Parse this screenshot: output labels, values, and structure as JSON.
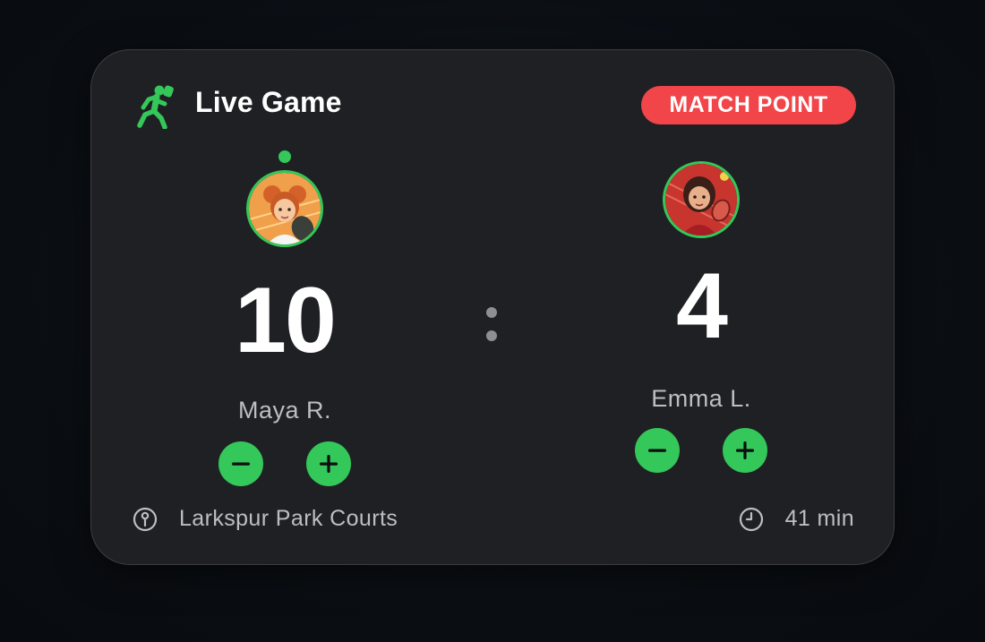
{
  "widget": {
    "title": "Live Game",
    "title_icon": "pickleball-player-icon",
    "status_badge": "MATCH POINT",
    "separator": ":",
    "location": "Larkspur Park Courts",
    "location_icon": "location-pin-icon",
    "duration": "41 min",
    "duration_icon": "clock-icon"
  },
  "players": [
    {
      "name": "Maya R.",
      "score": "10",
      "serving": true,
      "avatar": "avatar-maya"
    },
    {
      "name": "Emma L.",
      "score": "4",
      "serving": false,
      "avatar": "avatar-emma"
    }
  ],
  "colors": {
    "accent": "#34c759",
    "badge": "#f2454a",
    "card": "#1f2023",
    "muted_text": "#bdbec3"
  }
}
